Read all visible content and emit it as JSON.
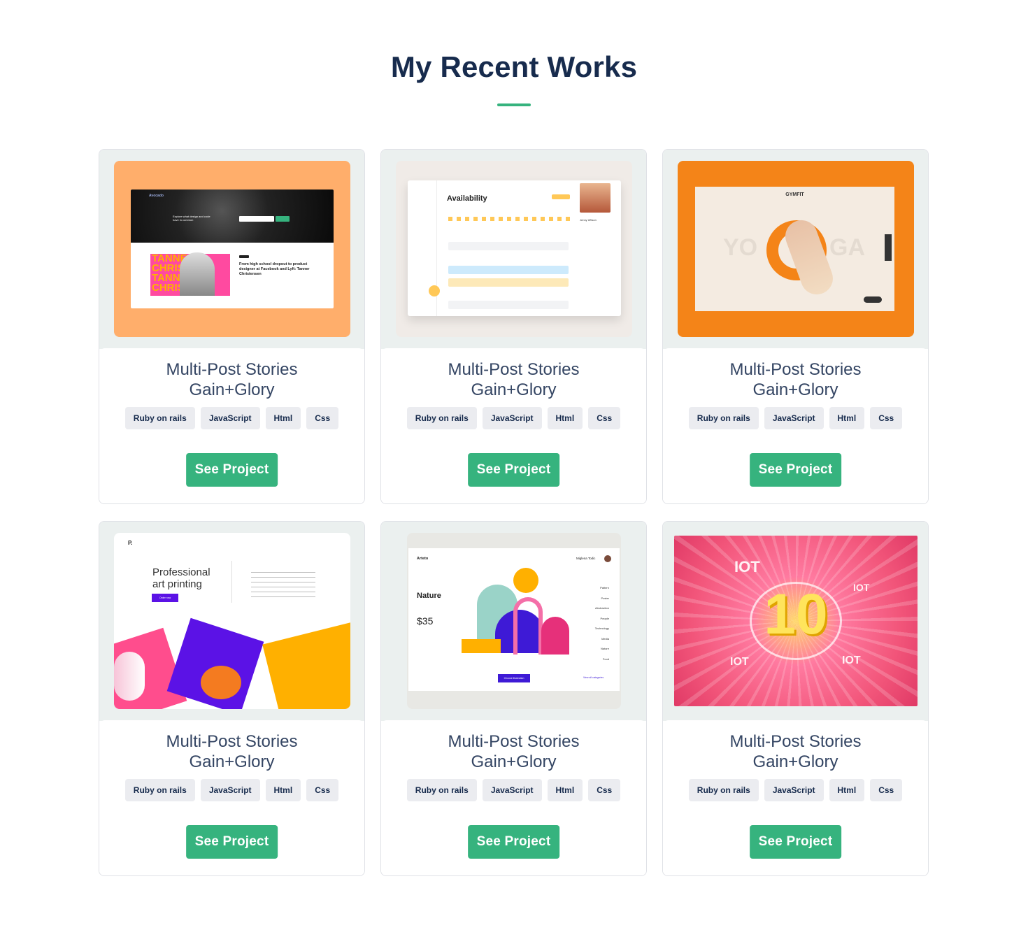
{
  "section": {
    "title": "My Recent Works"
  },
  "projects": [
    {
      "title": "Multi-Post Stories Gain+Glory",
      "tags": [
        "Ruby on rails",
        "JavaScript",
        "Html",
        "Css"
      ],
      "button": "See Project",
      "preview": {
        "bg": "#ffae6b",
        "brand": "Avocado",
        "headline": "Explore what design and code have in common",
        "tile_text": [
          "TANNE",
          "CHRIS",
          "TANNE",
          "CHRIS"
        ],
        "article": "From high school dropout to product designer at Facebook and Lyft: Tanner Christensen"
      }
    },
    {
      "title": "Multi-Post Stories Gain+Glory",
      "tags": [
        "Ruby on rails",
        "JavaScript",
        "Html",
        "Css"
      ],
      "button": "See Project",
      "preview": {
        "bg": "#f0ebe7",
        "heading": "Availability",
        "profile": "Jenny Wilson"
      }
    },
    {
      "title": "Multi-Post Stories Gain+Glory",
      "tags": [
        "Ruby on rails",
        "JavaScript",
        "Html",
        "Css"
      ],
      "button": "See Project",
      "preview": {
        "bg": "#f48418",
        "brand": "GYMFIT",
        "big_left": "YO",
        "big_right": "GA"
      }
    },
    {
      "title": "Multi-Post Stories Gain+Glory",
      "tags": [
        "Ruby on rails",
        "JavaScript",
        "Html",
        "Css"
      ],
      "button": "See Project",
      "preview": {
        "bg": "#ffffff",
        "logo": "P.",
        "heading_1": "Professional",
        "heading_2": "art printing",
        "cta": "Order now"
      }
    },
    {
      "title": "Multi-Post Stories Gain+Glory",
      "tags": [
        "Ruby on rails",
        "JavaScript",
        "Html",
        "Css"
      ],
      "button": "See Project",
      "preview": {
        "bg": "#e8e8e4",
        "brand": "Arteto",
        "user": "Miglena Todic",
        "product": "Nature",
        "price": "$35",
        "cta": "Choose illustration",
        "link": "View all categories",
        "categories": [
          "Pattern",
          "Poster",
          "Abstraction",
          "People",
          "Technology",
          "Media",
          "Nature",
          "Food"
        ]
      }
    },
    {
      "title": "Multi-Post Stories Gain+Glory",
      "tags": [
        "Ruby on rails",
        "JavaScript",
        "Html",
        "Css"
      ],
      "button": "See Project",
      "preview": {
        "bg": "#f2557a",
        "badge_main": "10",
        "iot_labels": [
          "IOT",
          "IOT",
          "IOT",
          "IOT"
        ]
      }
    }
  ]
}
